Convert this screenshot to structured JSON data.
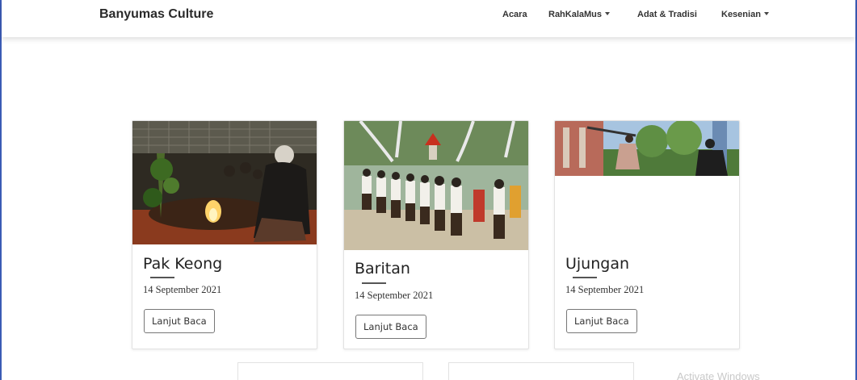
{
  "navbar": {
    "brand": "Banyumas Culture",
    "items": [
      {
        "label": "Acara",
        "dropdown": false
      },
      {
        "label": "RahKalaMus",
        "dropdown": true
      },
      {
        "label": "Adat & Tradisi",
        "dropdown": false
      },
      {
        "label": "Kesenian",
        "dropdown": true
      }
    ]
  },
  "cards": [
    {
      "title": "Pak Keong",
      "date": "14 September 2021",
      "button": "Lanjut Baca",
      "image": "ritual-ceremony-photo"
    },
    {
      "title": "Baritan",
      "date": "14 September 2021",
      "button": "Lanjut Baca",
      "image": "procession-photo"
    },
    {
      "title": "Ujungan",
      "date": "14 September 2021",
      "button": "Lanjut Baca",
      "image": "ujungan-performance-photo"
    }
  ],
  "watermark": "Activate Windows"
}
